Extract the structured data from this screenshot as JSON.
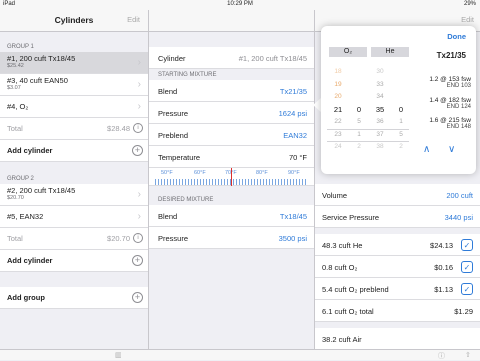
{
  "status": {
    "left": "iPad",
    "time": "10:29 PM",
    "right": "29%"
  },
  "left": {
    "title": "Cylinders",
    "edit": "Edit",
    "group1": {
      "header": "GROUP 1",
      "items": [
        {
          "main": "#1, 200 cuft Tx18/45",
          "sub": "$25.42"
        },
        {
          "main": "#3, 40 cuft EAN50",
          "sub": "$3.07"
        },
        {
          "main": "#4, O₂",
          "sub": ""
        }
      ],
      "total_label": "Total",
      "total_value": "$28.48",
      "add": "Add cylinder"
    },
    "group2": {
      "header": "GROUP 2",
      "items": [
        {
          "main": "#2, 200 cuft Tx18/45",
          "sub": "$20.70"
        },
        {
          "main": "#5, EAN32",
          "sub": ""
        }
      ],
      "total_label": "Total",
      "total_value": "$20.70",
      "add": "Add cylinder"
    },
    "add_group": "Add group"
  },
  "mid": {
    "cylinder_label": "Cylinder",
    "cylinder_value": "#1, 200 cuft Tx18/45",
    "starting_header": "STARTING MIXTURE",
    "blend_label": "Blend",
    "blend_value": "Tx21/35",
    "pressure_label": "Pressure",
    "pressure_value": "1624 psi",
    "preblend_label": "Preblend",
    "preblend_value": "EAN32",
    "temp_label": "Temperature",
    "temp_value": "70 °F",
    "temp_ticks": [
      "50°F",
      "60°F",
      "70°F",
      "80°F",
      "90°F"
    ],
    "desired_header": "DESIRED MIXTURE",
    "d_blend_label": "Blend",
    "d_blend_value": "Tx18/45",
    "d_pressure_label": "Pressure",
    "d_pressure_value": "3500 psi"
  },
  "right": {
    "edit": "Edit",
    "volume_label": "Volume",
    "volume_value": "200 cuft",
    "service_label": "Service Pressure",
    "service_value": "3440 psi",
    "rows": [
      {
        "label": "48.3 cuft He",
        "price": "$24.13"
      },
      {
        "label": "0.8 cuft O₂",
        "price": "$0.16"
      },
      {
        "label": "5.4 cuft O₂ preblend",
        "price": "$1.13"
      }
    ],
    "total_label": "6.1 cuft O₂ total",
    "total_value": "$1.29",
    "air_label": "38.2 cuft Air",
    "partial_right": [
      "i",
      "1",
      "1"
    ]
  },
  "popover": {
    "done": "Done",
    "o2_header": "O₂",
    "he_header": "He",
    "mix_name": "Tx21/35",
    "o2_wheel": [
      "18",
      "19",
      "20",
      "21",
      "22",
      "23",
      "24"
    ],
    "he_wheel": [
      "30",
      "33",
      "34",
      "35",
      "36",
      "37",
      "38"
    ],
    "third_wheel": [
      "",
      "",
      "",
      "0",
      "5",
      "1",
      "2"
    ],
    "depths": [
      {
        "line": "1.2 @ 153 fsw",
        "end": "END 103"
      },
      {
        "line": "1.4 @ 182 fsw",
        "end": "END 124"
      },
      {
        "line": "1.6 @ 215 fsw",
        "end": "END 148"
      }
    ],
    "up": "∧",
    "down": "∨"
  }
}
